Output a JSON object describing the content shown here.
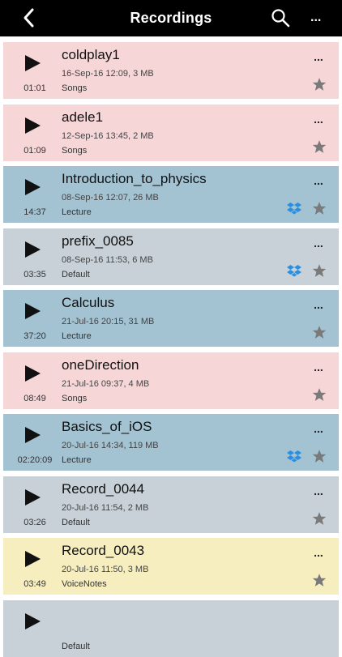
{
  "header": {
    "title": "Recordings",
    "more_label": "..."
  },
  "colors": {
    "Songs": "#f7d6d8",
    "Lecture": "#a3c3d3",
    "Default": "#c7d1d7",
    "VoiceNotes": "#f7eec0"
  },
  "recordings": [
    {
      "name": "coldplay1",
      "meta": "16-Sep-16 12:09, 3 MB",
      "duration": "01:01",
      "category": "Songs",
      "cloud": false,
      "more": "..."
    },
    {
      "name": "adele1",
      "meta": "12-Sep-16 13:45, 2 MB",
      "duration": "01:09",
      "category": "Songs",
      "cloud": false,
      "more": "..."
    },
    {
      "name": "Introduction_to_physics",
      "meta": "08-Sep-16 12:07, 26 MB",
      "duration": "14:37",
      "category": "Lecture",
      "cloud": true,
      "more": "..."
    },
    {
      "name": "prefix_0085",
      "meta": "08-Sep-16 11:53, 6 MB",
      "duration": "03:35",
      "category": "Default",
      "cloud": true,
      "more": "..."
    },
    {
      "name": "Calculus",
      "meta": "21-Jul-16 20:15, 31 MB",
      "duration": "37:20",
      "category": "Lecture",
      "cloud": false,
      "more": "..."
    },
    {
      "name": "oneDirection",
      "meta": "21-Jul-16 09:37, 4 MB",
      "duration": "08:49",
      "category": "Songs",
      "cloud": false,
      "more": "..."
    },
    {
      "name": "Basics_of_iOS",
      "meta": "20-Jul-16 14:34, 119 MB",
      "duration": "02:20:09",
      "category": "Lecture",
      "cloud": true,
      "more": "..."
    },
    {
      "name": "Record_0044",
      "meta": "20-Jul-16 11:54, 2 MB",
      "duration": "03:26",
      "category": "Default",
      "cloud": false,
      "more": "..."
    },
    {
      "name": "Record_0043",
      "meta": "20-Jul-16 11:50, 3 MB",
      "duration": "03:49",
      "category": "VoiceNotes",
      "cloud": false,
      "more": "..."
    },
    {
      "name": "",
      "meta": "",
      "duration": "",
      "category": "Default",
      "cloud": false,
      "more": ""
    }
  ]
}
